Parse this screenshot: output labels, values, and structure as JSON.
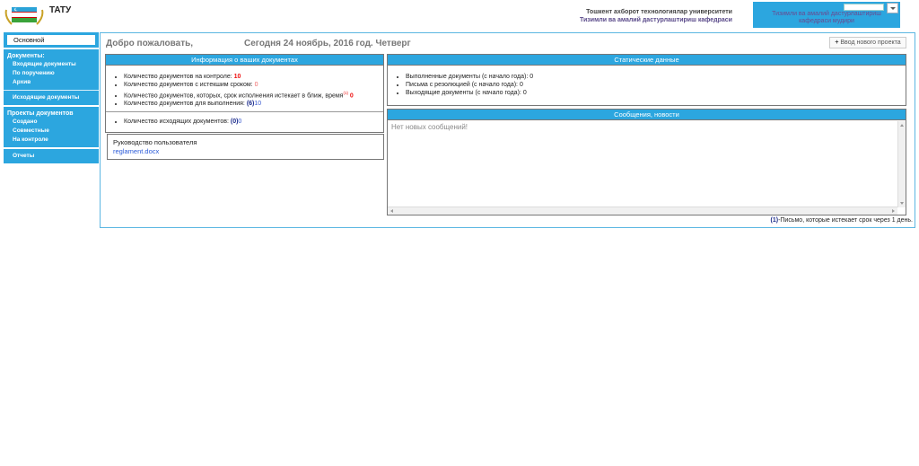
{
  "header": {
    "app_title": "TATУ",
    "org_line1": "Тошкент ахборот технологиялар университети",
    "org_line2": "Тизимли ва амалий дастурлаштириш кафедраси",
    "user_role_line1": "Тизимли ва амалий дастурлаштириш",
    "user_role_line2": "кафедраси мудири"
  },
  "sidebar": {
    "main_label": "Основной",
    "documents_heading": "Документы:",
    "incoming": "Входящие документы",
    "by_order": "По поручению",
    "archive": "Архив",
    "outgoing": "Исходящие документы",
    "projects_heading": "Проекты документов",
    "created": "Создано",
    "joint": "Совместные",
    "on_control": "На контроле",
    "reports": "Отчеты"
  },
  "main": {
    "welcome": "Добро пожаловать,",
    "date": "Сегодня 24 ноябрь, 2016 год. Четверг",
    "new_project_button": "Ввод нового проекта"
  },
  "info_panel": {
    "title": "Информация о ваших документах",
    "on_control_label": "Количество документов на контроле:",
    "on_control_value": "10",
    "expired_label": "Количество документов с истекшим сроком:",
    "expired_value": "0",
    "expiring_label": "Количество документов, которых, срок исполнения истекает в ближ, время",
    "expiring_mark": "(1)",
    "expiring_value": "0",
    "to_execute_label": "Количество документов для выполнения:",
    "to_execute_paren": "(6)",
    "to_execute_value": "10",
    "outgoing_label": "Количество исходящих документов:",
    "outgoing_paren": "(0)",
    "outgoing_value": "0"
  },
  "guide": {
    "title": "Руководство пользователя",
    "file": "reglament.docx"
  },
  "stat_panel": {
    "title": "Статические данные",
    "done_label": "Выполненные документы (с начало года):",
    "done_value": "0",
    "resolution_label": "Письма с резолюцией (с начало года):",
    "resolution_value": "0",
    "outgoing_label": "Выходящие документы (с начало года):",
    "outgoing_value": "0"
  },
  "messages": {
    "title": "Сообщения, новости",
    "empty_text": "Нет новых сообщений!"
  },
  "footnote": {
    "mark": "(1)",
    "text": "-Письмо, которые истекает срок через 1 день."
  }
}
